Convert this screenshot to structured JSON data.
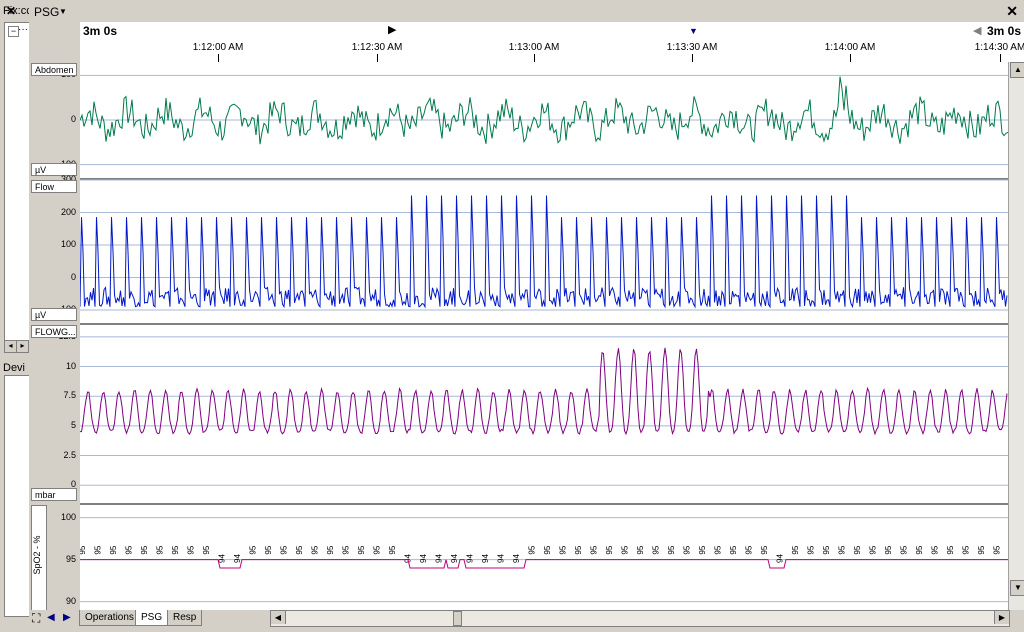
{
  "left_pane": {
    "title_top": "Fix:cc",
    "title_bottom": "Devi",
    "tree_node": "−",
    "tree_dots": "···"
  },
  "topbar": {
    "title": "PSG",
    "close": "✕"
  },
  "ruler": {
    "window_left": "3m 0s",
    "window_right": "3m 0s",
    "ticks": [
      "1:12:00 AM",
      "1:12:30 AM",
      "1:13:00 AM",
      "1:13:30 AM",
      "1:14:00 AM",
      "1:14:30 AM"
    ]
  },
  "channels": [
    {
      "name": "Abdomen",
      "unit": "µV",
      "ticks": [
        "100",
        "0",
        "-100"
      ],
      "color": "#007a4a"
    },
    {
      "name": "Flow",
      "unit": "µV",
      "ticks": [
        "300",
        "200",
        "100",
        "0",
        "-100"
      ],
      "color": "#0018c8"
    },
    {
      "name": "FLOWG...",
      "unit": "mbar",
      "ticks": [
        "12.5",
        "10",
        "7.5",
        "5",
        "2.5",
        "0"
      ],
      "color": "#800080"
    },
    {
      "name": "SpO2 - %",
      "unit": "",
      "ticks": [
        "100",
        "95",
        "90"
      ],
      "color": "#c0007a"
    }
  ],
  "spo2_values": {
    "label_common": "95",
    "label_dip": "94"
  },
  "bottom": {
    "tabs": [
      "Operations",
      "PSG",
      "Resp"
    ],
    "active_tab": "PSG"
  }
}
